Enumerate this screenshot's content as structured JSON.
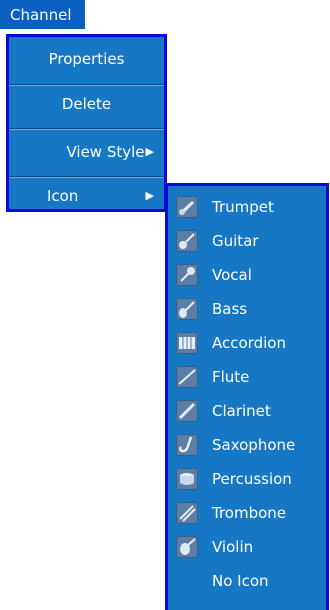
{
  "menubar": {
    "channel_label": "Channel"
  },
  "context_menu": {
    "items": [
      {
        "label": "Properties"
      },
      {
        "label": "Delete"
      },
      {
        "label": "View Style",
        "submenu_arrow": "▶"
      },
      {
        "label": "Icon",
        "submenu_arrow": "▶"
      }
    ]
  },
  "icon_submenu": {
    "items": [
      {
        "label": "Trumpet",
        "icon": "trumpet-icon"
      },
      {
        "label": "Guitar",
        "icon": "guitar-icon"
      },
      {
        "label": "Vocal",
        "icon": "microphone-icon"
      },
      {
        "label": "Bass",
        "icon": "bass-icon"
      },
      {
        "label": "Accordion",
        "icon": "accordion-icon"
      },
      {
        "label": "Flute",
        "icon": "flute-icon"
      },
      {
        "label": "Clarinet",
        "icon": "clarinet-icon"
      },
      {
        "label": "Saxophone",
        "icon": "saxophone-icon"
      },
      {
        "label": "Percussion",
        "icon": "drum-icon"
      },
      {
        "label": "Trombone",
        "icon": "trombone-icon"
      },
      {
        "label": "Violin",
        "icon": "violin-icon"
      },
      {
        "label": "No Icon",
        "icon": ""
      }
    ]
  },
  "colors": {
    "menu_bg": "#1678c4",
    "menu_border": "#0a0ad8",
    "menubar_bg": "#0a5fc0",
    "text": "#ffffff"
  }
}
